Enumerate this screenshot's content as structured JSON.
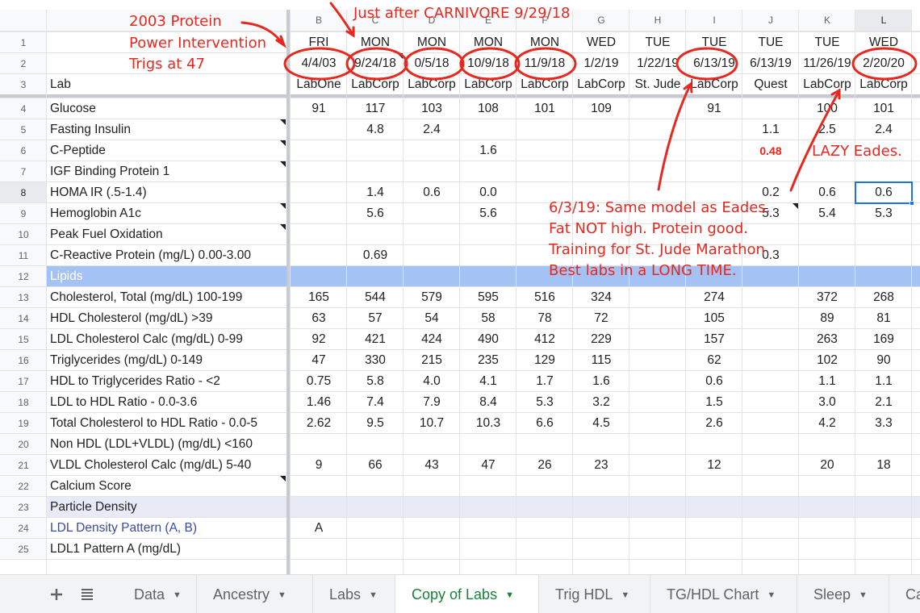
{
  "columns": [
    "B",
    "C",
    "D",
    "E",
    "F",
    "G",
    "H",
    "I",
    "J",
    "K",
    "L"
  ],
  "row_numbers": [
    "1",
    "2",
    "3",
    "4",
    "5",
    "6",
    "7",
    "8",
    "9",
    "10",
    "11",
    "12",
    "13",
    "14",
    "15",
    "16",
    "17",
    "18",
    "19",
    "20",
    "21",
    "22",
    "23",
    "24",
    "25"
  ],
  "header_rows": {
    "days": [
      "FRI",
      "MON",
      "MON",
      "MON",
      "MON",
      "WED",
      "TUE",
      "TUE",
      "TUE",
      "TUE",
      "WED"
    ],
    "dates": [
      "4/4/03",
      "9/24/18",
      "0/5/18",
      "10/9/18",
      "11/9/18",
      "1/2/19",
      "1/22/19",
      "6/13/19",
      "6/13/19",
      "11/26/19",
      "2/20/20"
    ],
    "lab_label": "Lab",
    "labs": [
      "LabOne",
      "LabCorp",
      "LabCorp",
      "LabCorp",
      "LabCorp",
      "LabCorp",
      "St. Jude",
      "LabCorp",
      "Quest",
      "LabCorp",
      "LabCorp"
    ]
  },
  "rows": [
    {
      "label": "Glucose",
      "values": [
        "91",
        "117",
        "103",
        "108",
        "101",
        "109",
        "",
        "91",
        "",
        "100",
        "101"
      ]
    },
    {
      "label": "Fasting Insulin",
      "values": [
        "",
        "4.8",
        "2.4",
        "",
        "",
        "",
        "",
        "",
        "1.1",
        "2.5",
        "2.4"
      ]
    },
    {
      "label": "C-Peptide",
      "values": [
        "",
        "",
        "",
        "1.6",
        "",
        "",
        "",
        "",
        "0.48",
        "",
        ""
      ]
    },
    {
      "label": "IGF Binding Protein 1",
      "values": [
        "",
        "",
        "",
        "",
        "",
        "",
        "",
        "",
        "",
        "",
        ""
      ]
    },
    {
      "label": "HOMA IR (.5-1.4)",
      "values": [
        "",
        "1.4",
        "0.6",
        "0.0",
        "",
        "",
        "",
        "",
        "0.2",
        "0.6",
        "0.6"
      ]
    },
    {
      "label": "Hemoglobin A1c",
      "values": [
        "",
        "5.6",
        "",
        "5.6",
        "",
        "",
        "",
        "",
        "5.3",
        "5.4",
        "5.3"
      ]
    },
    {
      "label": "Peak Fuel Oxidation",
      "values": [
        "",
        "",
        "",
        "",
        "",
        "",
        "",
        "",
        "",
        "",
        ""
      ]
    },
    {
      "label": "C-Reactive Protein (mg/L) 0.00-3.00",
      "values": [
        "",
        "0.69",
        "",
        "",
        "",
        "",
        "",
        "",
        "0.3",
        "",
        ""
      ]
    },
    {
      "label": "Lipids",
      "values": [
        "",
        "",
        "",
        "",
        "",
        "",
        "",
        "",
        "",
        "",
        ""
      ]
    },
    {
      "label": "Cholesterol, Total (mg/dL) 100-199",
      "values": [
        "165",
        "544",
        "579",
        "595",
        "516",
        "324",
        "",
        "274",
        "",
        "372",
        "268"
      ]
    },
    {
      "label": "HDL Cholesterol (mg/dL) >39",
      "values": [
        "63",
        "57",
        "54",
        "58",
        "78",
        "72",
        "",
        "105",
        "",
        "89",
        "81"
      ]
    },
    {
      "label": "LDL Cholesterol Calc (mg/dL) 0-99",
      "values": [
        "92",
        "421",
        "424",
        "490",
        "412",
        "229",
        "",
        "157",
        "",
        "263",
        "169"
      ]
    },
    {
      "label": "Triglycerides (mg/dL) 0-149",
      "values": [
        "47",
        "330",
        "215",
        "235",
        "129",
        "115",
        "",
        "62",
        "",
        "102",
        "90"
      ]
    },
    {
      "label": "HDL to Triglycerides Ratio - <2",
      "values": [
        "0.75",
        "5.8",
        "4.0",
        "4.1",
        "1.7",
        "1.6",
        "",
        "0.6",
        "",
        "1.1",
        "1.1"
      ]
    },
    {
      "label": "LDL to HDL Ratio - 0.0-3.6",
      "values": [
        "1.46",
        "7.4",
        "7.9",
        "8.4",
        "5.3",
        "3.2",
        "",
        "1.5",
        "",
        "3.0",
        "2.1"
      ]
    },
    {
      "label": "Total Cholesterol to HDL Ratio - 0.0-5",
      "values": [
        "2.62",
        "9.5",
        "10.7",
        "10.3",
        "6.6",
        "4.5",
        "",
        "2.6",
        "",
        "4.2",
        "3.3"
      ]
    },
    {
      "label": "Non HDL (LDL+VLDL) (mg/dL) <160",
      "values": [
        "",
        "",
        "",
        "",
        "",
        "",
        "",
        "",
        "",
        "",
        ""
      ]
    },
    {
      "label": "VLDL Cholesterol Calc (mg/dL) 5-40",
      "values": [
        "9",
        "66",
        "43",
        "47",
        "26",
        "23",
        "",
        "12",
        "",
        "20",
        "18"
      ]
    },
    {
      "label": "Calcium Score",
      "values": [
        "",
        "",
        "",
        "",
        "",
        "",
        "",
        "",
        "",
        "",
        ""
      ]
    },
    {
      "label": "Particle Density",
      "values": [
        "",
        "",
        "",
        "",
        "",
        "",
        "",
        "",
        "",
        "",
        ""
      ]
    },
    {
      "label": "LDL Density Pattern (A, B)",
      "values": [
        "A",
        "",
        "",
        "",
        "",
        "",
        "",
        "",
        "",
        "",
        ""
      ]
    },
    {
      "label": "LDL1 Pattern A (mg/dL)",
      "values": [
        "",
        "",
        "",
        "",
        "",
        "",
        "",
        "",
        "",
        "",
        ""
      ]
    }
  ],
  "annotations": {
    "top_left_1": "2003 Protein",
    "top_left_2": "Power Intervention",
    "top_left_3": "Trigs at 47",
    "top_center": "Just after CARNIVORE 9/29/18",
    "lazy": "LAZY Eades.",
    "note_1": "6/3/19: Same model as Eades.",
    "note_2": "Fat NOT high. Protein good.",
    "note_3": "Training for St. Jude Marathon",
    "note_4": "Best labs in a LONG TIME."
  },
  "tabs": {
    "add_icon": "plus-icon",
    "list_icon": "all-sheets-icon",
    "items": [
      "Data",
      "Ancestry",
      "Labs",
      "Copy of Labs",
      "Trig  HDL",
      "TG/HDL Chart",
      "Sleep",
      "Ca"
    ],
    "active": "Copy of Labs"
  },
  "colors": {
    "annotation_red": "#e8281f",
    "lipids_band": "#a4c2f4",
    "particle_band": "#e8eaf6",
    "active_tab": "#188038",
    "selection": "#1a73e8"
  }
}
